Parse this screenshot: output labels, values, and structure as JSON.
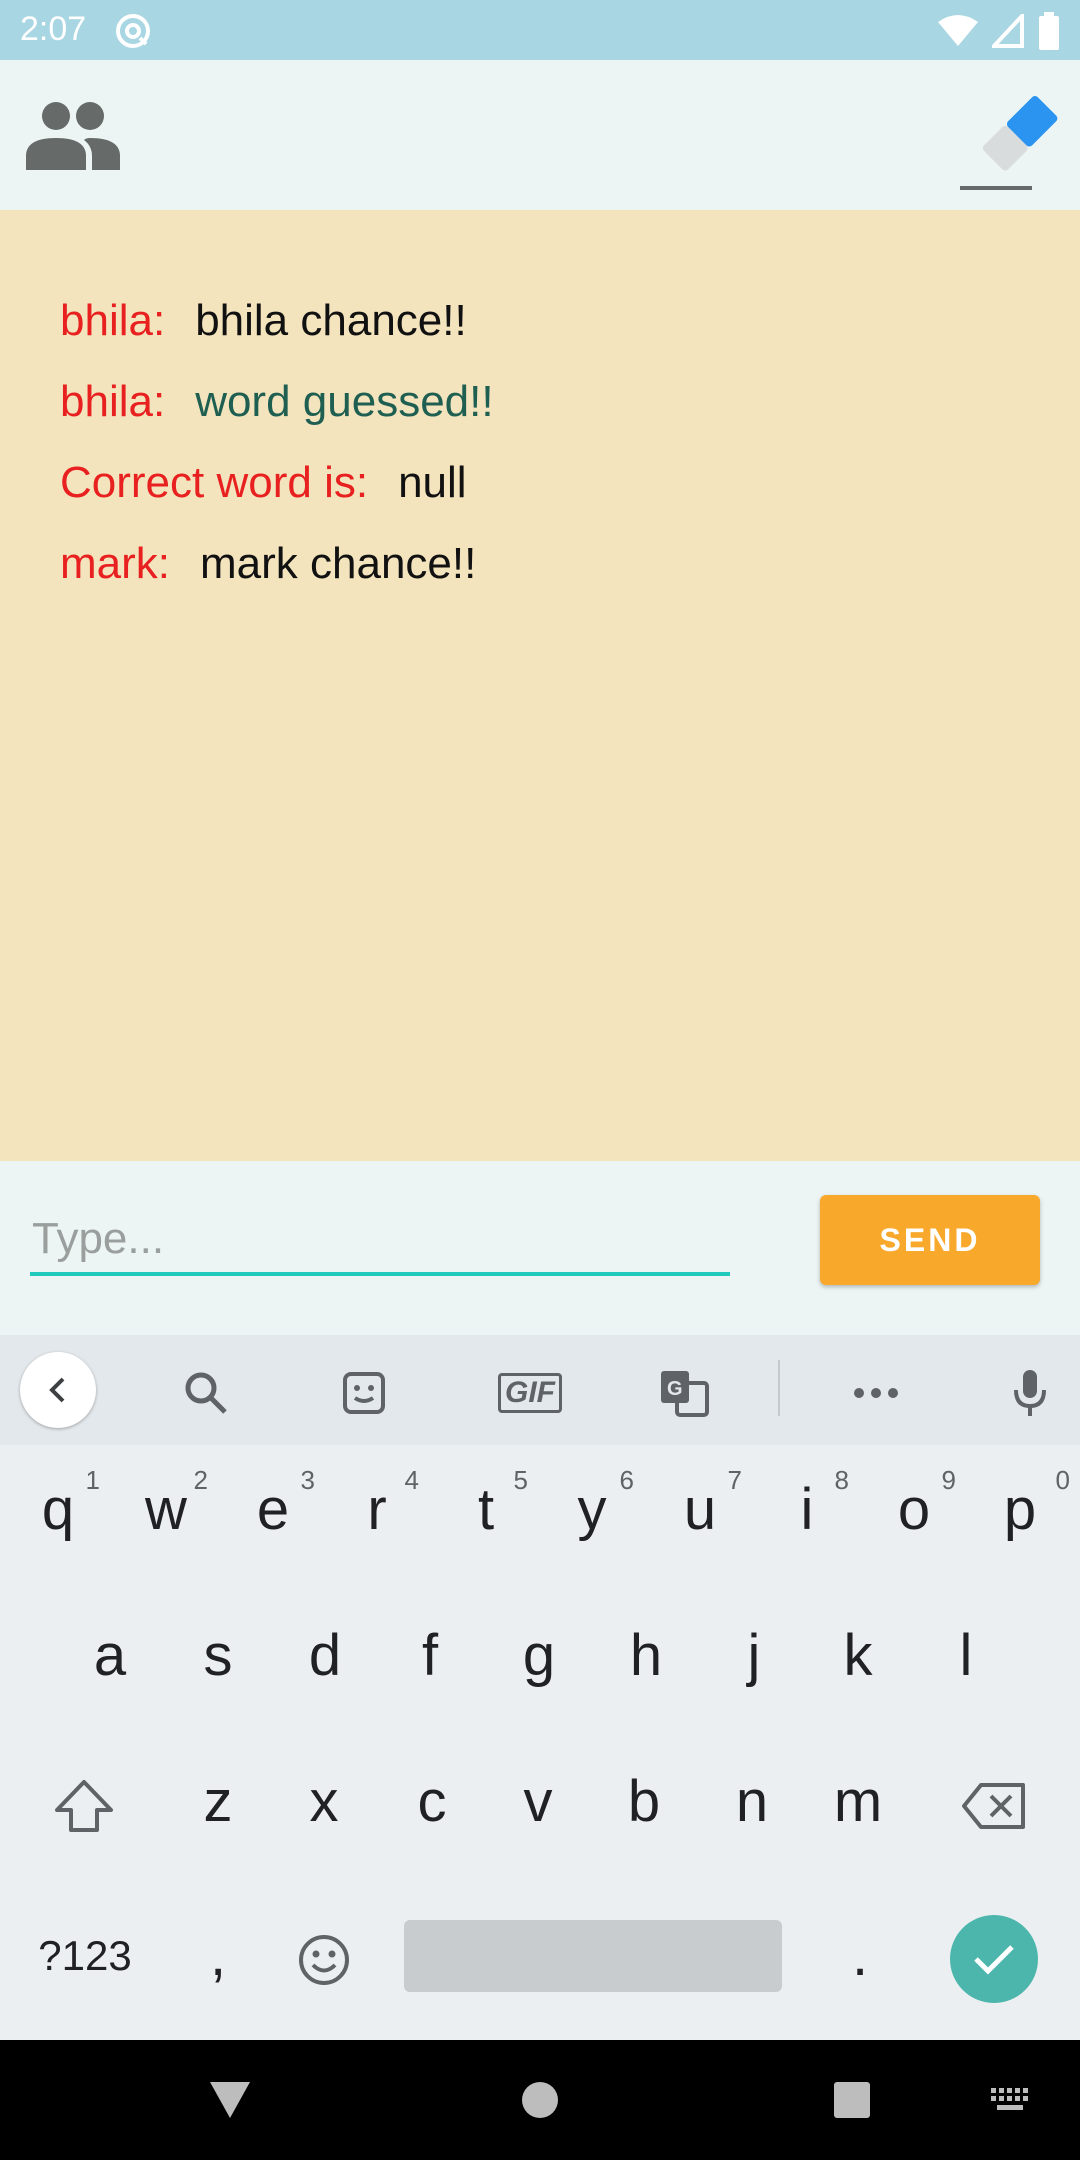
{
  "status_bar": {
    "time": "2:07"
  },
  "chat": {
    "messages": [
      {
        "sender": "bhila:",
        "text": "bhila chance!!",
        "style": "normal"
      },
      {
        "sender": "bhila:",
        "text": "word guessed!!",
        "style": "green"
      },
      {
        "sender": "Correct word is:",
        "text": "null",
        "style": "normal"
      },
      {
        "sender": "mark:",
        "text": "mark chance!!",
        "style": "normal"
      }
    ]
  },
  "input": {
    "placeholder": "Type...",
    "send_label": "SEND"
  },
  "keyboard": {
    "toolbar": {
      "gif_label": "GIF"
    },
    "row1": [
      {
        "key": "q",
        "hint": "1"
      },
      {
        "key": "w",
        "hint": "2"
      },
      {
        "key": "e",
        "hint": "3"
      },
      {
        "key": "r",
        "hint": "4"
      },
      {
        "key": "t",
        "hint": "5"
      },
      {
        "key": "y",
        "hint": "6"
      },
      {
        "key": "u",
        "hint": "7"
      },
      {
        "key": "i",
        "hint": "8"
      },
      {
        "key": "o",
        "hint": "9"
      },
      {
        "key": "p",
        "hint": "0"
      }
    ],
    "row2": [
      "a",
      "s",
      "d",
      "f",
      "g",
      "h",
      "j",
      "k",
      "l"
    ],
    "row3": [
      "z",
      "x",
      "c",
      "v",
      "b",
      "n",
      "m"
    ],
    "row4": {
      "symbols": "?123",
      "comma": ",",
      "period": "."
    }
  },
  "colors": {
    "status_bar": "#a8d6e3",
    "chat_bg": "#f3e4bd",
    "sender": "#e8201f",
    "guessed": "#1f5f52",
    "send_button": "#f8a82a",
    "input_underline": "#20c9bc",
    "enter_key": "#4db6ac"
  },
  "icons": [
    "sync-icon",
    "wifi-icon",
    "signal-icon",
    "battery-icon",
    "people-icon",
    "eraser-icon",
    "search-icon",
    "sticker-icon",
    "translate-icon",
    "more-icon",
    "mic-icon",
    "shift-icon",
    "backspace-icon",
    "emoji-icon",
    "check-icon"
  ]
}
